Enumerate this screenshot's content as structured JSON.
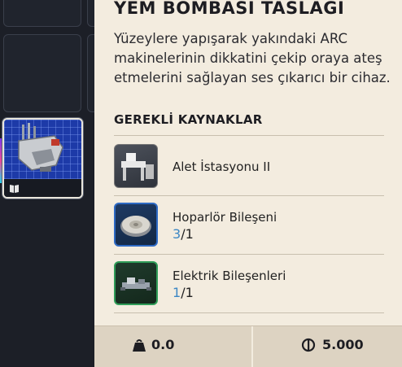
{
  "item": {
    "title": "YEM BOMBASI TASLAĞI",
    "description": "Yüzeylere yapışarak yakındaki ARC makinelerinin dikkatini çekip oraya ateş etmelerini sağlayan ses çıkarıcı bir cihaz."
  },
  "requirements": {
    "heading": "GEREKLİ KAYNAKLAR",
    "items": [
      {
        "name": "Alet İstasyonu II",
        "thumb_icon": "workbench-icon"
      },
      {
        "name": "Hoparlör Bileşeni",
        "have": "3",
        "need": "/1",
        "thumb_icon": "speaker-component-icon"
      },
      {
        "name": "Elektrik Bileşenleri",
        "have": "1",
        "need": "/1",
        "thumb_icon": "electrical-component-icon"
      }
    ]
  },
  "stats": {
    "weight": "0.0",
    "value": "5.000",
    "weight_icon": "weight-icon",
    "value_icon": "coin-icon"
  },
  "colors": {
    "panel_bg": "#f3ecdf",
    "have_qty": "#3c87c4",
    "blueprint": "#1d3aa8"
  }
}
